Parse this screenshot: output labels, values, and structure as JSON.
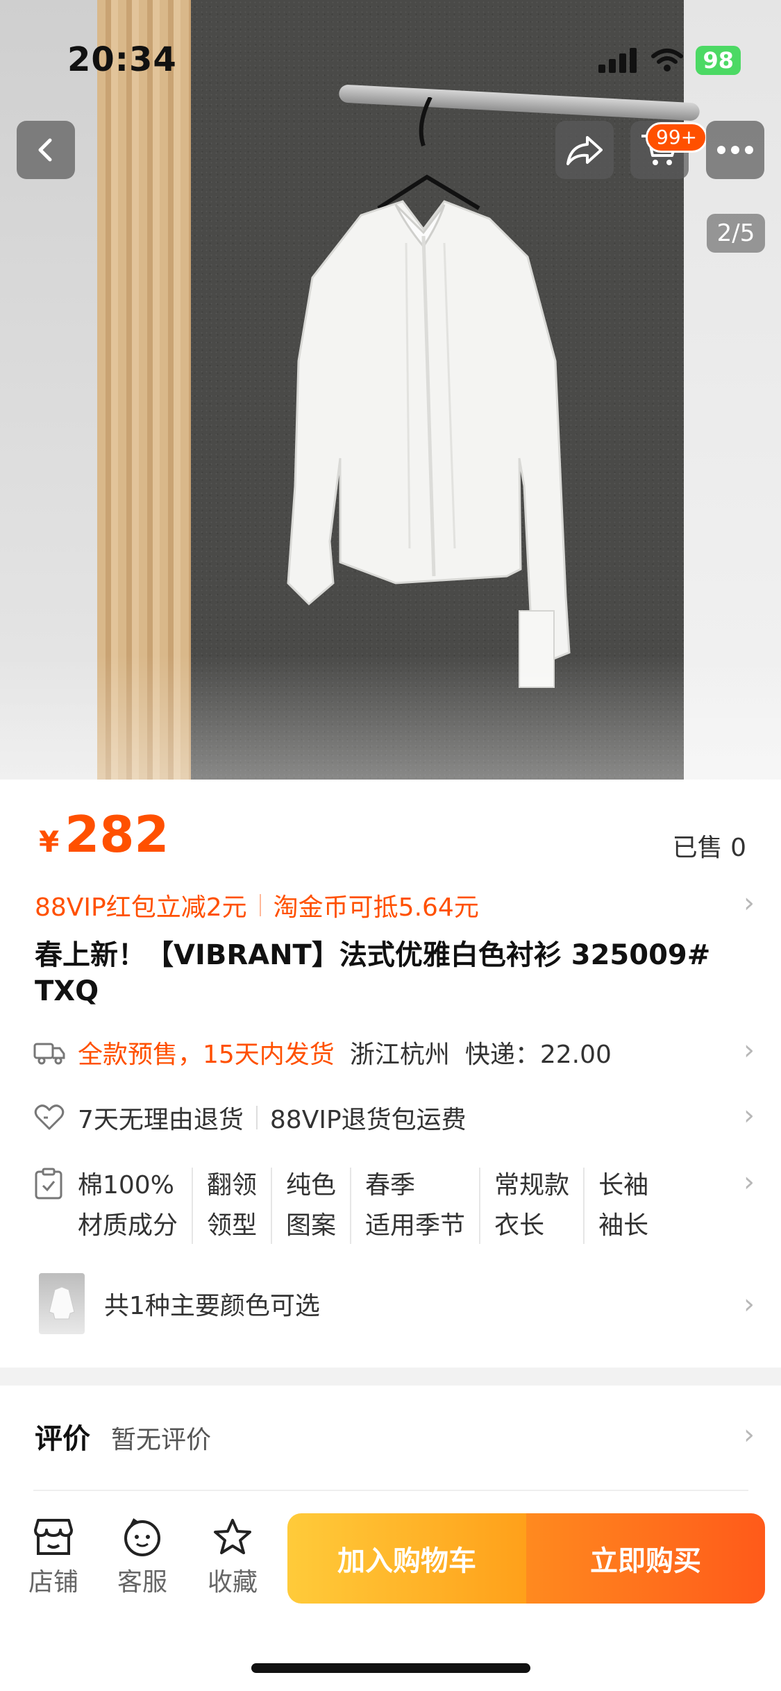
{
  "status_bar": {
    "time": "20:34",
    "battery": "98"
  },
  "gallery": {
    "cart_badge": "99+",
    "page_indicator": "2/5"
  },
  "product": {
    "currency": "¥",
    "price": "282",
    "sold": "已售 0",
    "promo_1": "88VIP红包立减2元",
    "promo_2": "淘金币可抵5.64元",
    "title": "春上新！【VIBRANT】法式优雅白色衬衫  325009# TXQ"
  },
  "shipping": {
    "presale": "全款预售，15天内发货",
    "location": "浙江杭州",
    "express": "快递：22.00"
  },
  "service": {
    "return": "7天无理由退货",
    "vip_return": "88VIP退货包运费"
  },
  "attributes": [
    {
      "value": "棉100%",
      "key": "材质成分"
    },
    {
      "value": "翻领",
      "key": "领型"
    },
    {
      "value": "纯色",
      "key": "图案"
    },
    {
      "value": "春季",
      "key": "适用季节"
    },
    {
      "value": "常规款",
      "key": "衣长"
    },
    {
      "value": "长袖",
      "key": "袖长"
    }
  ],
  "colors": {
    "label": "共1种主要颜色可选"
  },
  "reviews": {
    "heading": "评价",
    "summary": "暂无评价"
  },
  "bottom_bar": {
    "store": "店铺",
    "service": "客服",
    "favorite": "收藏",
    "add_to_cart": "加入购物车",
    "buy_now": "立即购买"
  },
  "colors_theme": {
    "accent": "#ff5000",
    "cart_gradient": "#ffa01a",
    "buy_gradient": "#ff5a1a"
  },
  "icons": [
    "back-icon",
    "share-icon",
    "cart-icon",
    "more-icon",
    "truck-icon",
    "heart-icon",
    "clipboard-icon",
    "store-icon",
    "service-icon",
    "star-icon",
    "chevron-right-icon"
  ]
}
